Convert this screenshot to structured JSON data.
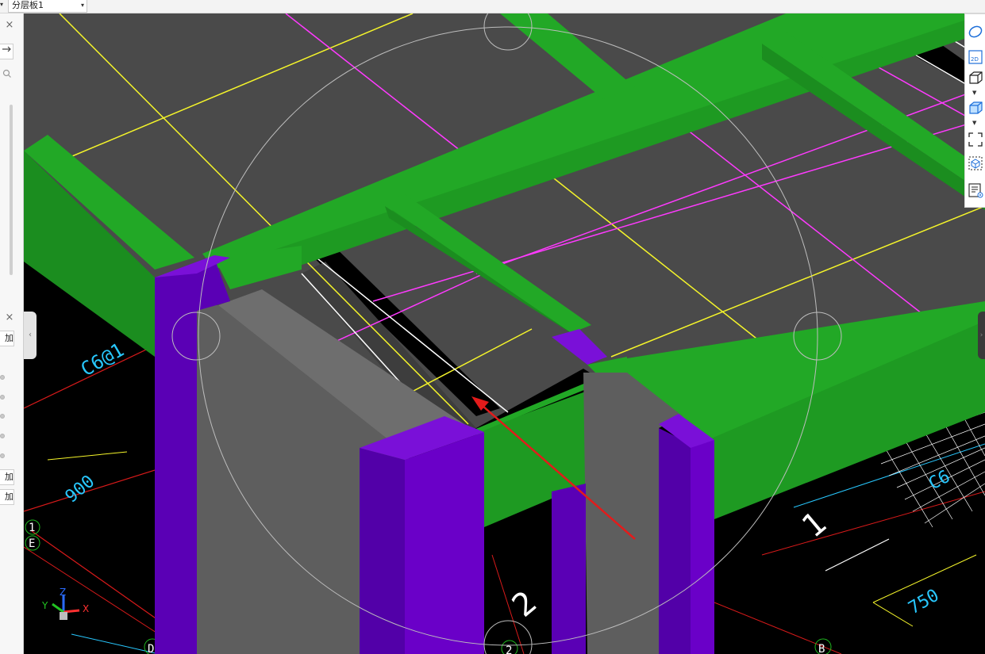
{
  "topbar": {
    "floor_selector": "分层板1"
  },
  "left_panel": {
    "close_symbol": "×",
    "buttons": [
      "加",
      "加",
      "加"
    ]
  },
  "viewport": {
    "annotations": {
      "rebar_label": "C6@1",
      "dim_900": "900",
      "dim_750": "750",
      "rebar_label_right": "C6",
      "grid_1": "1",
      "grid_E": "E",
      "grid_D": "D",
      "grid_2": "2",
      "grid_B": "B",
      "mark_1": "1",
      "mark_2": "2"
    },
    "axis_triad": {
      "x": "X",
      "y": "Y",
      "z": "Z"
    },
    "colors": {
      "slab": "#4a4a4a",
      "beam_green": "#22a826",
      "beam_green_dark": "#1b8d1f",
      "column_purple": "#6a00c8",
      "column_purple_dark": "#5200a8",
      "wall_gray": "#5e5e5e",
      "grid_yellow": "#f5f52a",
      "grid_magenta": "#ff3aff",
      "cad_red": "#d81a1a",
      "cad_cyan": "#28c8ff",
      "orbit_circle": "#bdbdbd"
    }
  },
  "right_toolbar": {
    "icons": [
      "orbit-icon",
      "2d-view-icon",
      "3d-box-icon",
      "3d-solid-icon",
      "zoom-extents-icon",
      "select-box-icon",
      "layer-list-icon"
    ],
    "label_2d": "2D"
  }
}
